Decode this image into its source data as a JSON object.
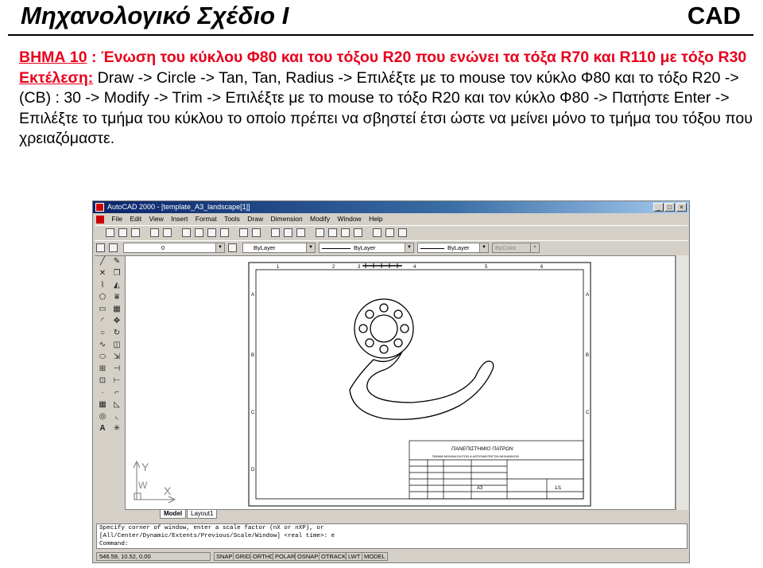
{
  "header": {
    "title": "Μηχανολογικό Σχέδιο  Ι",
    "cad": "CAD"
  },
  "description": {
    "step_label": "ΒΗΜΑ 10",
    "step_text": " : Ένωση του κύκλου Φ80 και του τόξου R20 που ενώνει τα τόξα R70 και R110 με τόξο R30",
    "exec_label": "Εκτέλεση:",
    "exec_text": " Draw -> Circle -> Tan, Tan, Radius -> Επιλέξτε με το mouse τον κύκλο Φ80 και το τόξο R20 -> (CB) : 30 -> Modify -> Trim -> Επιλέξτε με το mouse το τόξο R20 και τον κύκλο Φ80 -> Πατήστε Enter -> Επιλέξτε το τμήμα του κύκλου το οποίο πρέπει να σβηστεί έτσι ώστε να μείνει μόνο το τμήμα του τόξου που χρειαζόμαστε."
  },
  "autocad": {
    "title": "AutoCAD 2000 - [template_A3_landscape[1]]",
    "menu": [
      "File",
      "Edit",
      "View",
      "Insert",
      "Format",
      "Tools",
      "Draw",
      "Dimension",
      "Modify",
      "Window",
      "Help"
    ],
    "layer_value": "0",
    "color_value": "ByLayer",
    "linetype_value": "ByLayer",
    "lineweight_value": "ByLayer",
    "plotstyle_value": "ByColor",
    "tabs": [
      "Model",
      "Layout1"
    ],
    "command_lines": [
      "Specify corner of window, enter a scale factor (nX or nXP), or",
      "[All/Center/Dynamic/Extents/Previous/Scale/Window] <real time>: e",
      "Command:"
    ],
    "coords": "546.59, 10.52, 0.00",
    "status_buttons": [
      "SNAP",
      "GRID",
      "ORTHO",
      "POLAR",
      "OSNAP",
      "OTRACK",
      "LWT",
      "MODEL"
    ],
    "titleblock": {
      "university": "ΠΑΝΕΠΙΣΤΗΜΙΟ  ΠΑΤΡΩΝ",
      "department": "ΤΜΗΜΑ ΜΗΧΑΝΟΛΟΓΩΝ & ΑΕΡΟΝΑΥΠΗΓΩΝ ΜΗΧΑΝΙΚΩΝ",
      "paper": "A3",
      "scale": "1/1"
    },
    "border_top_numbers": [
      "1",
      "2",
      "3",
      "4",
      "5",
      "6"
    ],
    "border_side_letters": [
      "A",
      "B",
      "C",
      "D"
    ],
    "ucs_labels": [
      "Y",
      "W",
      "X"
    ]
  }
}
